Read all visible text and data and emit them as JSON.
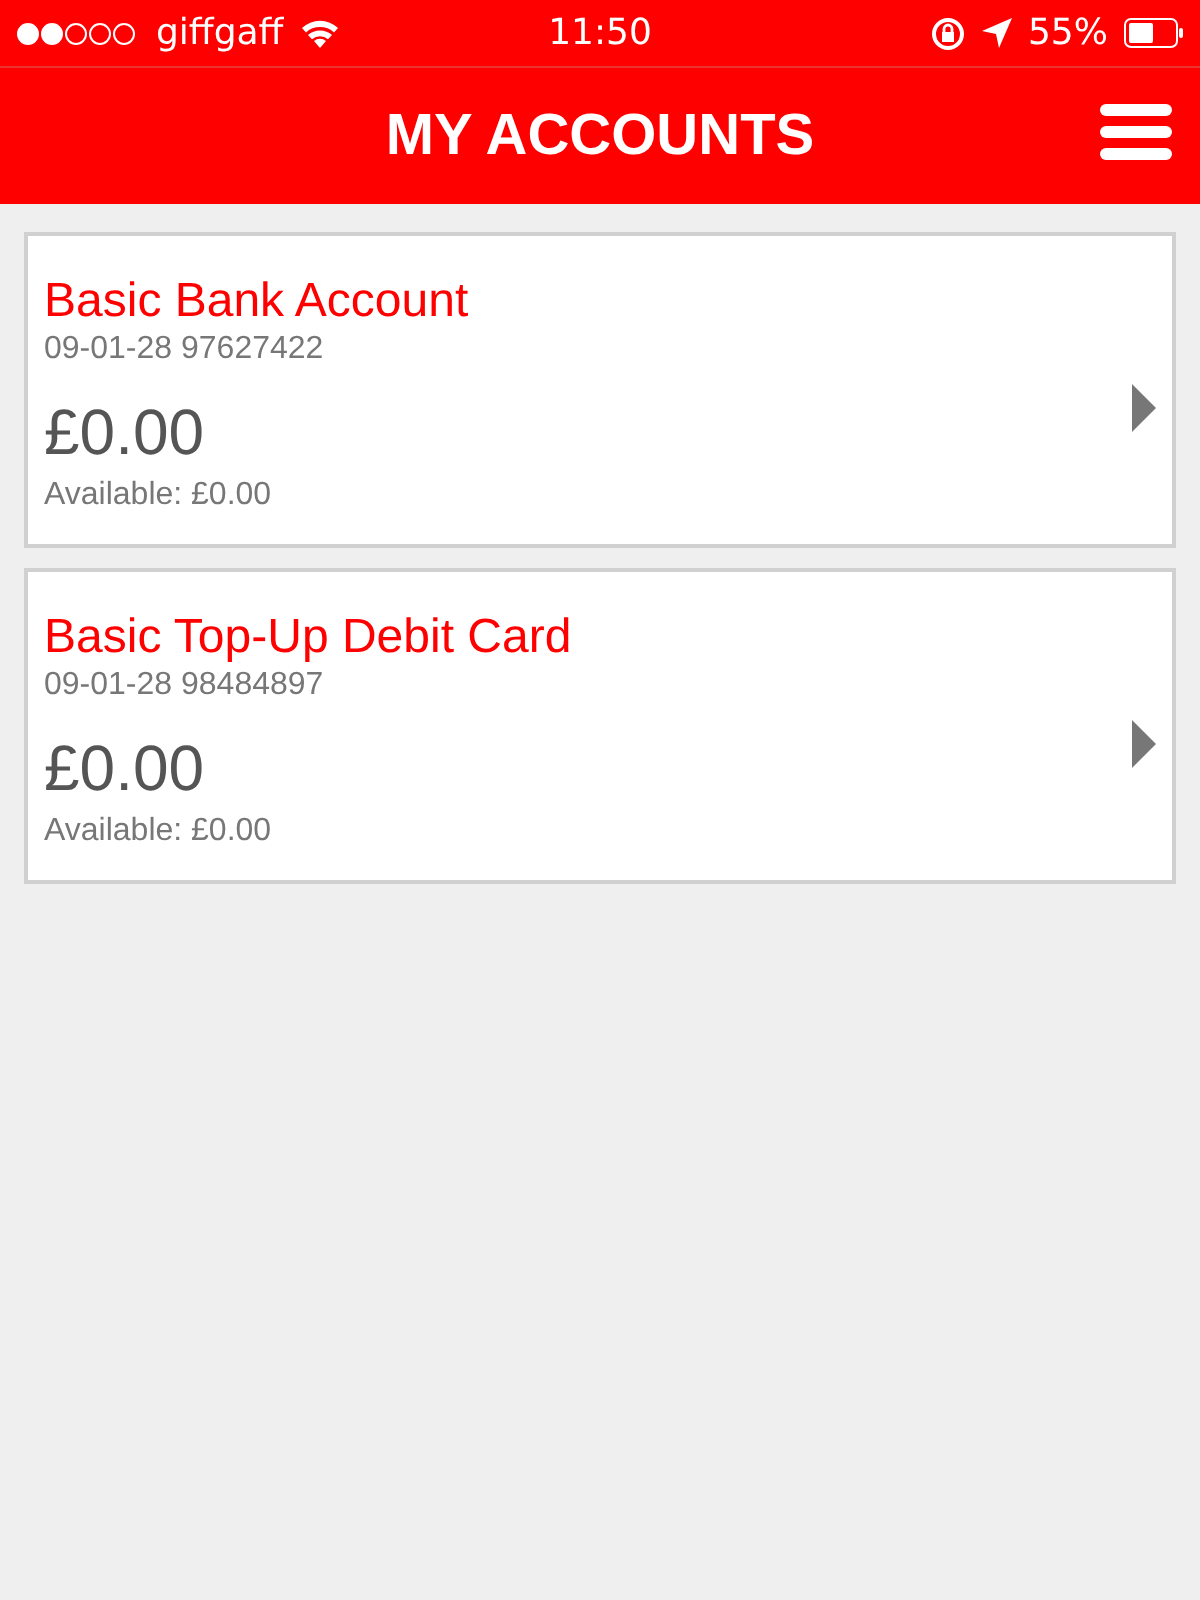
{
  "status_bar": {
    "carrier": "giffgaff",
    "time": "11:50",
    "battery": "55%"
  },
  "header": {
    "title": "MY ACCOUNTS"
  },
  "accounts": [
    {
      "name": "Basic Bank Account",
      "number": "09-01-28 97627422",
      "balance": "£0.00",
      "available": "Available: £0.00"
    },
    {
      "name": "Basic Top-Up Debit Card",
      "number": "09-01-28 98484897",
      "balance": "£0.00",
      "available": "Available: £0.00"
    }
  ]
}
